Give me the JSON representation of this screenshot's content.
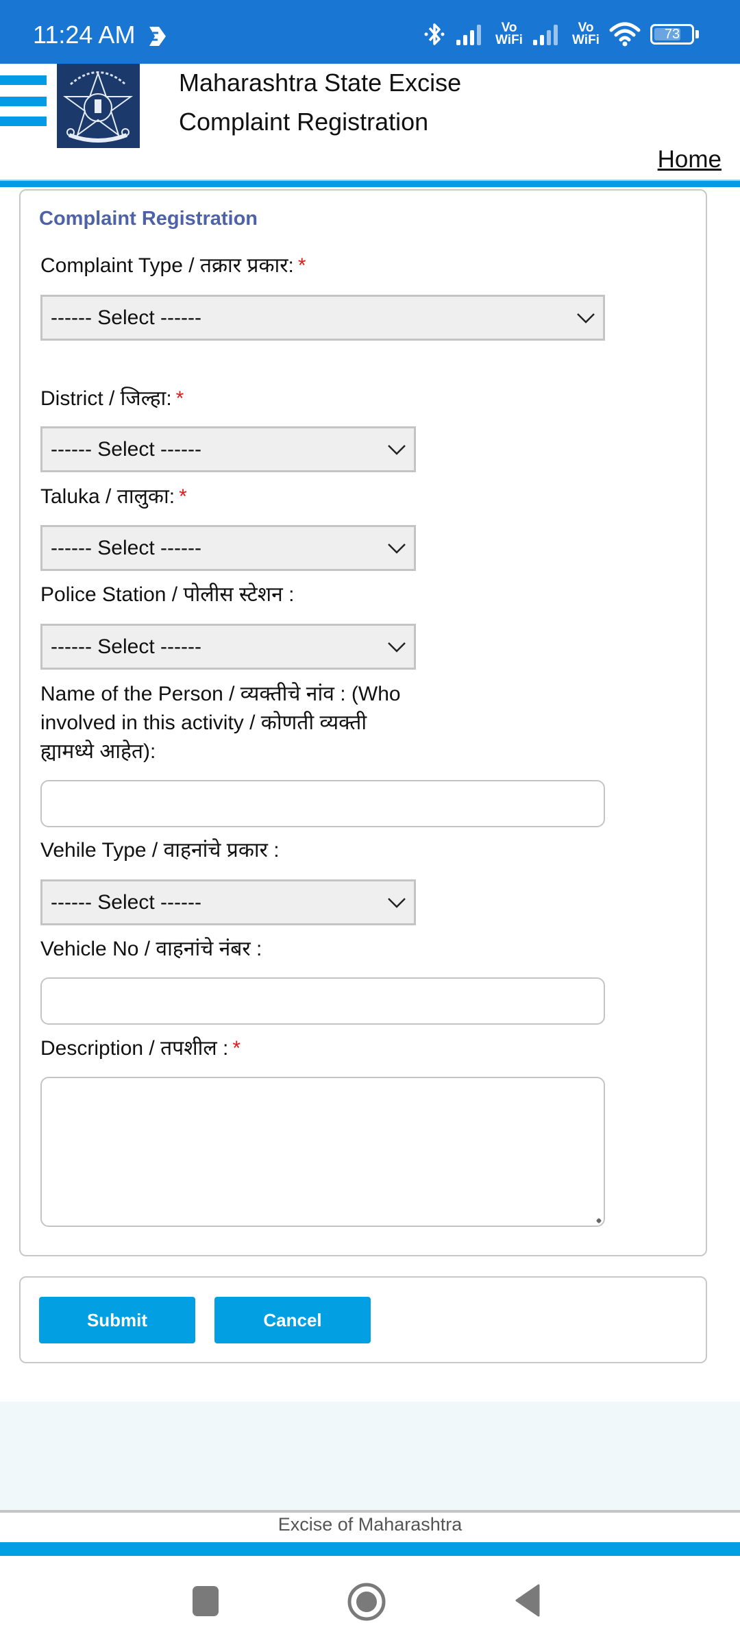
{
  "status_bar": {
    "time": "11:24 AM",
    "sim1_label": "Vo WiFi",
    "sim2_label": "Vo WiFi",
    "battery_percent": "73",
    "battery_level": 0.73,
    "icons": [
      "cast-icon",
      "bluetooth-icon",
      "signal-icon",
      "vowifi-icon",
      "signal-icon",
      "vowifi-icon",
      "wifi-icon",
      "battery-icon"
    ]
  },
  "header": {
    "title_line1": "Maharashtra State Excise",
    "title_line2": "Complaint Registration",
    "home_link": "Home",
    "menu_icon": "hamburger-menu-icon",
    "logo": "maharashtra-excise-emblem"
  },
  "form": {
    "heading": "Complaint Registration",
    "required_marker": "*",
    "fields": {
      "complaint_type": {
        "label": "Complaint Type / तक्रार प्रकार:",
        "required": true,
        "value": "------ Select ------"
      },
      "district": {
        "label": "District / जिल्हा:",
        "required": true,
        "value": "------ Select ------"
      },
      "taluka": {
        "label": "Taluka / तालुका:",
        "required": true,
        "value": "------ Select ------"
      },
      "police_station": {
        "label": "Police Station / पोलीस स्टेशन :",
        "required": false,
        "value": "------ Select ------"
      },
      "person_name": {
        "label_lines": [
          "Name of the Person / व्यक्तीचे नांव : (Who",
          "involved in this activity / कोणती व्यक्ती",
          "ह्यामध्ये आहेत):"
        ],
        "required": false,
        "value": ""
      },
      "vehicle_type": {
        "label": "Vehile Type / वाहनांचे प्रकार :",
        "required": false,
        "value": "------ Select ------"
      },
      "vehicle_no": {
        "label": "Vehicle No / वाहनांचे नंबर :",
        "required": false,
        "value": ""
      },
      "description": {
        "label": "Description / तपशील :",
        "required": true,
        "value": ""
      }
    }
  },
  "actions": {
    "submit_label": "Submit",
    "cancel_label": "Cancel"
  },
  "footer": {
    "text": "Excise of Maharashtra"
  },
  "colors": {
    "status_bar": "#1976D2",
    "accent": "#039FE3",
    "heading": "#4D62A8",
    "required": "#E01B1B"
  }
}
